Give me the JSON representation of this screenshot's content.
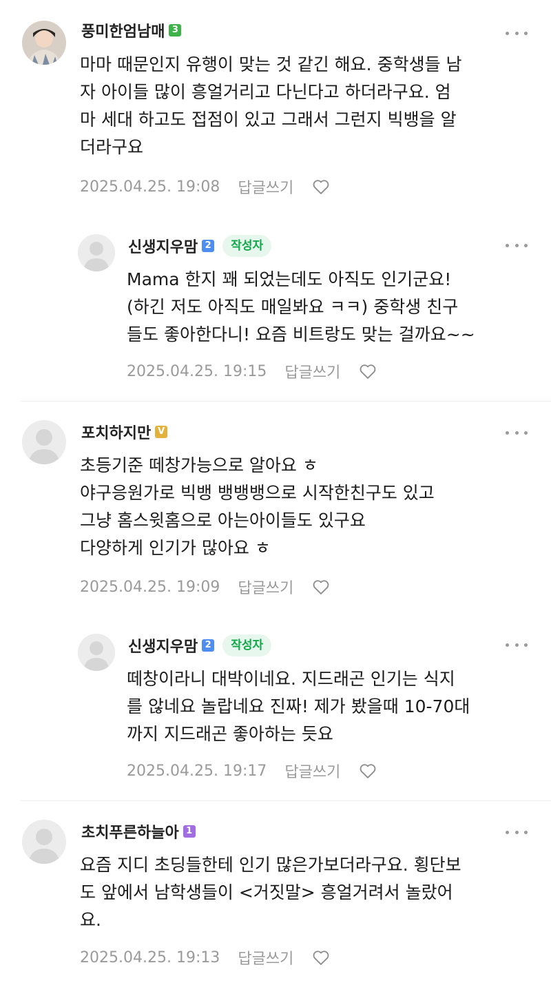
{
  "comments": [
    {
      "nickname": "풍미한엄남매",
      "level": "3",
      "level_color": "#3db34a",
      "text": "마마 때문인지 유행이 맞는 것 같긴 해요. 중학생들 남\n자 아이들 많이 흥얼거리고 다닌다고 하더라구요. 엄\n마 세대 하고도 접점이 있고 그래서 그런지 빅뱅을 알\n더라구요",
      "date": "2025.04.25. 19:08",
      "reply_label": "답글쓰기"
    },
    {
      "nickname": "신생지우맘",
      "level": "2",
      "level_color": "#4e8ef0",
      "author_badge": "작성자",
      "text": "Mama 한지 꽤 되었는데도 아직도 인기군요!\n(하긴 저도 아직도 매일봐요 ㅋㅋ) 중학생 친구\n들도 좋아한다니! 요즘 비트랑도 맞는 걸까요~~",
      "date": "2025.04.25. 19:15",
      "reply_label": "답글쓰기"
    },
    {
      "nickname": "포치하지만",
      "level": "V",
      "level_color": "#e3b23c",
      "text": "초등기준 떼창가능으로 알아요 ㅎ\n야구응원가로 빅뱅 뱅뱅뱅으로 시작한친구도 있고\n그냥 홈스윗홈으로 아는아이들도 있구요\n다양하게 인기가 많아요 ㅎ",
      "date": "2025.04.25. 19:09",
      "reply_label": "답글쓰기"
    },
    {
      "nickname": "신생지우맘",
      "level": "2",
      "level_color": "#4e8ef0",
      "author_badge": "작성자",
      "text": "떼창이라니 대박이네요. 지드래곤 인기는 식지\n를 않네요 놀랍네요 진짜! 제가 봤을때 10-70대\n까지 지드래곤 좋아하는 듯요",
      "date": "2025.04.25. 19:17",
      "reply_label": "답글쓰기"
    },
    {
      "nickname": "초치푸른하늘아",
      "level": "1",
      "level_color": "#a06ee0",
      "text": "요즘 지디 초딩들한테 인기 많은가보더라구요. 횡단보\n도 앞에서 남학생들이 <거짓말> 흥얼거려서 놀랐어\n요.",
      "date": "2025.04.25. 19:13",
      "reply_label": "답글쓰기"
    }
  ]
}
